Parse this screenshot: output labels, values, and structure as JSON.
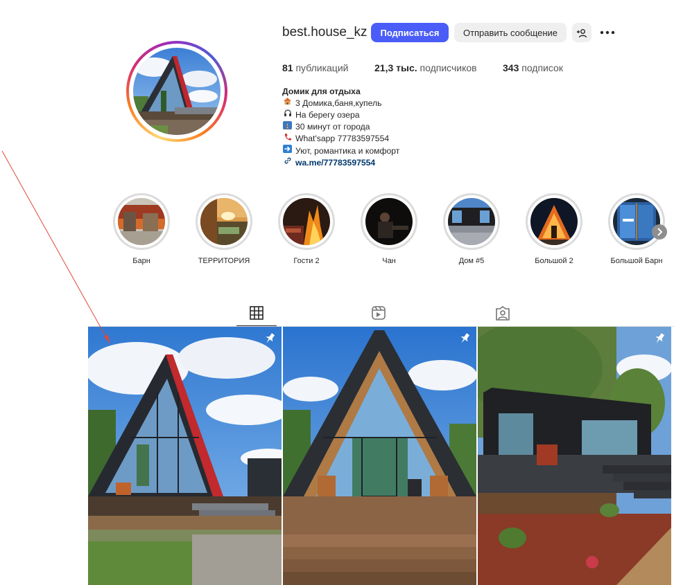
{
  "profile": {
    "username": "best.house_kz",
    "follow_label": "Подписаться",
    "message_label": "Отправить сообщение",
    "suggest_icon": "person-plus-icon",
    "more_icon": "more-dots-icon"
  },
  "stats": {
    "posts_count": "81",
    "posts_label": "публикаций",
    "followers_count": "21,3 тыс.",
    "followers_label": "подписчиков",
    "following_count": "343",
    "following_label": "подписок"
  },
  "bio": {
    "name": "Домик для отдыха",
    "lines": [
      {
        "icon": "house-icon",
        "text": "3 Домика,баня,купель"
      },
      {
        "icon": "headphones-icon",
        "text": "На берегу озера"
      },
      {
        "icon": "highway-icon",
        "text": "30 минут от города"
      },
      {
        "icon": "phone-icon",
        "text": "What'sapp 77783597554"
      },
      {
        "icon": "arrow-right-icon",
        "text": "Уют, романтика и комфорт"
      }
    ],
    "link_icon": "link-icon",
    "link": "wa.me/77783597554"
  },
  "highlights": [
    {
      "label": "Барн"
    },
    {
      "label": "ТЕРРИТОРИЯ"
    },
    {
      "label": "Гости 2"
    },
    {
      "label": "Чан"
    },
    {
      "label": "Дом #5"
    },
    {
      "label": "Большой 2"
    },
    {
      "label": "Большой Барн"
    }
  ],
  "highlights_next_icon": "chevron-right-icon",
  "tabs": [
    {
      "icon": "grid-icon",
      "active": true
    },
    {
      "icon": "reels-icon",
      "active": false
    },
    {
      "icon": "tagged-icon",
      "active": false
    }
  ],
  "posts": [
    {
      "pinned": true,
      "icon": "pin-icon"
    },
    {
      "pinned": true,
      "icon": "pin-icon"
    },
    {
      "pinned": true,
      "icon": "pin-icon"
    }
  ],
  "colors": {
    "primary_button": "#4a5df9",
    "annotation_arrow": "#e0483b",
    "link": "#00376b"
  }
}
